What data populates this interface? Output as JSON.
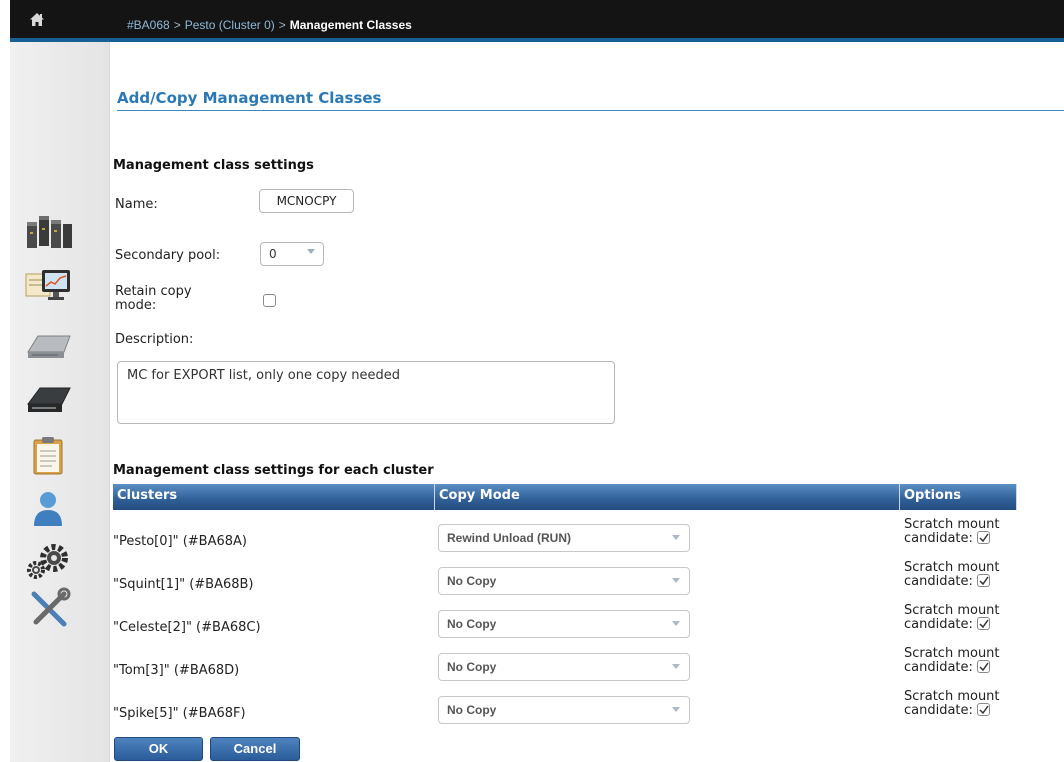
{
  "breadcrumb": {
    "items": [
      "#BA068",
      "Pesto (Cluster 0)"
    ],
    "separator": ">",
    "current": "Management Classes"
  },
  "nav": {
    "icons": [
      "cluster-icon",
      "monitor-icon",
      "physical-drive-icon",
      "tape-library-icon",
      "log-clipboard-icon",
      "user-icon",
      "settings-gears-icon",
      "tools-icon"
    ]
  },
  "page": {
    "title": "Add/Copy Management Classes",
    "settings_heading": "Management class settings",
    "name_label": "Name:",
    "name_value": "MCNOCPY",
    "secondary_pool_label": "Secondary pool:",
    "secondary_pool_value": "0",
    "retain_label_line1": "Retain copy",
    "retain_label_line2": "mode:",
    "retain_checked": false,
    "description_label": "Description:",
    "description_value": "MC for EXPORT list, only one copy needed"
  },
  "cluster_table": {
    "heading": "Management class settings for each cluster",
    "columns": [
      "Clusters",
      "Copy Mode",
      "Options"
    ],
    "rows": [
      {
        "cluster": "\"Pesto[0]\" (#BA68A)",
        "copy_mode": "Rewind Unload (RUN)",
        "option_line1": "Scratch mount",
        "option_line2": "candidate:",
        "checked": true
      },
      {
        "cluster": "\"Squint[1]\" (#BA68B)",
        "copy_mode": "No Copy",
        "option_line1": "Scratch mount",
        "option_line2": "candidate:",
        "checked": true
      },
      {
        "cluster": "\"Celeste[2]\" (#BA68C)",
        "copy_mode": "No Copy",
        "option_line1": "Scratch mount",
        "option_line2": "candidate:",
        "checked": true
      },
      {
        "cluster": "\"Tom[3]\" (#BA68D)",
        "copy_mode": "No Copy",
        "option_line1": "Scratch mount",
        "option_line2": "candidate:",
        "checked": true
      },
      {
        "cluster": "\"Spike[5]\" (#BA68F)",
        "copy_mode": "No Copy",
        "option_line1": "Scratch mount",
        "option_line2": "candidate:",
        "checked": true
      }
    ]
  },
  "buttons": {
    "ok": "OK",
    "cancel": "Cancel"
  },
  "colors": {
    "topbar": "#141414",
    "accent": "#2a79b6",
    "header": "#2f5f97"
  }
}
